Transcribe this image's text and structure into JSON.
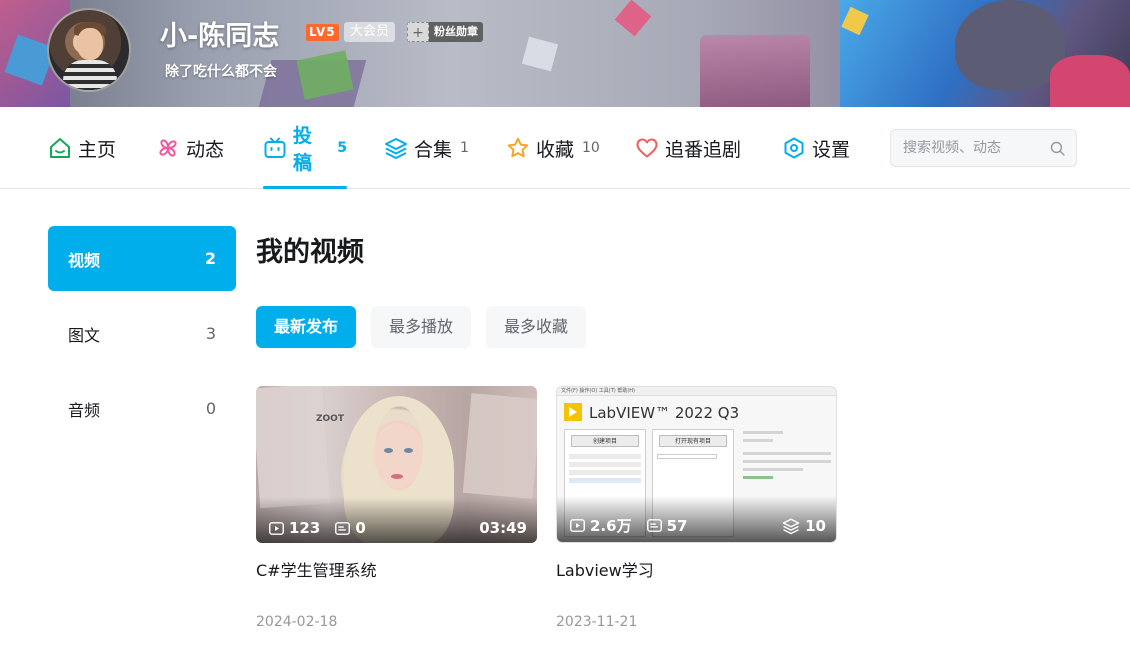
{
  "user": {
    "name": "小-陈同志",
    "level": "LV5",
    "vip": "大会员",
    "medal_label": "粉丝勋章",
    "signature": "除了吃什么都不会"
  },
  "nav": {
    "tabs": [
      {
        "label": "主页",
        "count": "",
        "icon": "home-icon"
      },
      {
        "label": "动态",
        "count": "",
        "icon": "pinwheel-icon"
      },
      {
        "label": "投稿",
        "count": "5",
        "icon": "tv-icon",
        "active": true
      },
      {
        "label": "合集",
        "count": "1",
        "icon": "layers-icon"
      },
      {
        "label": "收藏",
        "count": "10",
        "icon": "star-icon"
      },
      {
        "label": "追番追剧",
        "count": "",
        "icon": "heart-icon"
      },
      {
        "label": "设置",
        "count": "",
        "icon": "settings-hexagon-icon"
      }
    ],
    "search_placeholder": "搜索视频、动态"
  },
  "sidebar": {
    "items": [
      {
        "label": "视频",
        "count": "2",
        "active": true
      },
      {
        "label": "图文",
        "count": "3"
      },
      {
        "label": "音频",
        "count": "0"
      }
    ]
  },
  "main": {
    "title": "我的视频",
    "filters": [
      {
        "label": "最新发布",
        "active": true
      },
      {
        "label": "最多播放"
      },
      {
        "label": "最多收藏"
      }
    ],
    "videos": [
      {
        "title": "C#学生管理系统",
        "plays": "123",
        "danmaku": "0",
        "duration": "03:49",
        "date": "2024-02-18",
        "thumb_text": "ZOOT"
      },
      {
        "title": "Labview学习",
        "plays": "2.6万",
        "danmaku": "57",
        "episodes": "10",
        "date": "2023-11-21",
        "thumb_brand": "LabVIEW™ 2022 Q3",
        "thumb_menu": "文件(F)  操作(O)  工具(T)  帮助(H)",
        "thumb_btn1": "创建项目",
        "thumb_btn2": "打开现有项目"
      }
    ]
  },
  "colors": {
    "accent": "#00aeec",
    "level": "#ff6a2b",
    "text": "#18191c",
    "muted": "#61666d",
    "date": "#9499a0"
  }
}
